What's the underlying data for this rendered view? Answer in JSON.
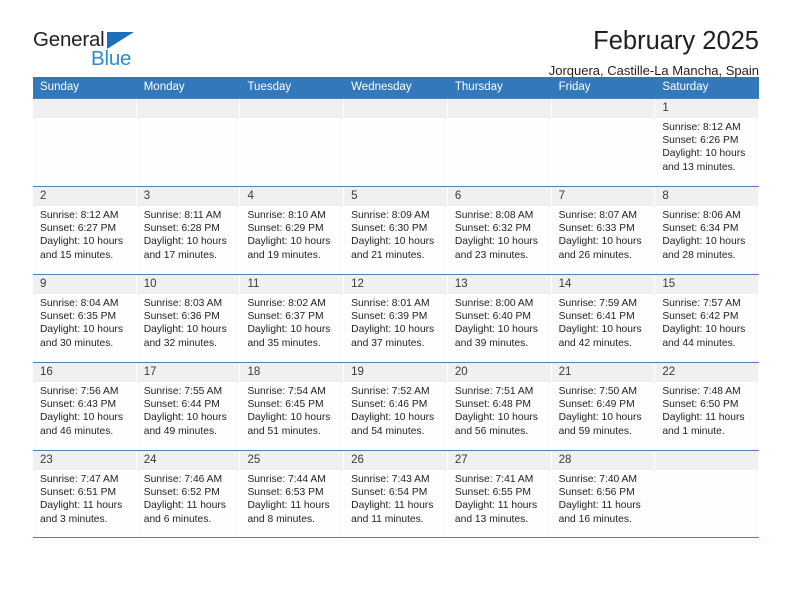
{
  "brand": {
    "name_part1": "General",
    "name_part2": "Blue",
    "triangle_color": "#1c6fba",
    "blue_text_color": "#2e8ad4"
  },
  "header": {
    "title": "February 2025",
    "location": "Jorquera, Castille-La Mancha, Spain"
  },
  "theme": {
    "header_bar_color": "#3478bc",
    "daynum_strip_color": "#f0f0f0",
    "grid_line_color": "#4a84c0",
    "text_color": "#231f20"
  },
  "calendar": {
    "weekdays": [
      "Sunday",
      "Monday",
      "Tuesday",
      "Wednesday",
      "Thursday",
      "Friday",
      "Saturday"
    ],
    "labels": {
      "sunrise": "Sunrise:",
      "sunset": "Sunset:",
      "daylight": "Daylight:"
    },
    "weeks": [
      [
        {
          "day": "",
          "sunrise": "",
          "sunset": "",
          "daylight_line1": "",
          "daylight_line2": ""
        },
        {
          "day": "",
          "sunrise": "",
          "sunset": "",
          "daylight_line1": "",
          "daylight_line2": ""
        },
        {
          "day": "",
          "sunrise": "",
          "sunset": "",
          "daylight_line1": "",
          "daylight_line2": ""
        },
        {
          "day": "",
          "sunrise": "",
          "sunset": "",
          "daylight_line1": "",
          "daylight_line2": ""
        },
        {
          "day": "",
          "sunrise": "",
          "sunset": "",
          "daylight_line1": "",
          "daylight_line2": ""
        },
        {
          "day": "",
          "sunrise": "",
          "sunset": "",
          "daylight_line1": "",
          "daylight_line2": ""
        },
        {
          "day": "1",
          "sunrise": "Sunrise: 8:12 AM",
          "sunset": "Sunset: 6:26 PM",
          "daylight_line1": "Daylight: 10 hours",
          "daylight_line2": "and 13 minutes."
        }
      ],
      [
        {
          "day": "2",
          "sunrise": "Sunrise: 8:12 AM",
          "sunset": "Sunset: 6:27 PM",
          "daylight_line1": "Daylight: 10 hours",
          "daylight_line2": "and 15 minutes."
        },
        {
          "day": "3",
          "sunrise": "Sunrise: 8:11 AM",
          "sunset": "Sunset: 6:28 PM",
          "daylight_line1": "Daylight: 10 hours",
          "daylight_line2": "and 17 minutes."
        },
        {
          "day": "4",
          "sunrise": "Sunrise: 8:10 AM",
          "sunset": "Sunset: 6:29 PM",
          "daylight_line1": "Daylight: 10 hours",
          "daylight_line2": "and 19 minutes."
        },
        {
          "day": "5",
          "sunrise": "Sunrise: 8:09 AM",
          "sunset": "Sunset: 6:30 PM",
          "daylight_line1": "Daylight: 10 hours",
          "daylight_line2": "and 21 minutes."
        },
        {
          "day": "6",
          "sunrise": "Sunrise: 8:08 AM",
          "sunset": "Sunset: 6:32 PM",
          "daylight_line1": "Daylight: 10 hours",
          "daylight_line2": "and 23 minutes."
        },
        {
          "day": "7",
          "sunrise": "Sunrise: 8:07 AM",
          "sunset": "Sunset: 6:33 PM",
          "daylight_line1": "Daylight: 10 hours",
          "daylight_line2": "and 26 minutes."
        },
        {
          "day": "8",
          "sunrise": "Sunrise: 8:06 AM",
          "sunset": "Sunset: 6:34 PM",
          "daylight_line1": "Daylight: 10 hours",
          "daylight_line2": "and 28 minutes."
        }
      ],
      [
        {
          "day": "9",
          "sunrise": "Sunrise: 8:04 AM",
          "sunset": "Sunset: 6:35 PM",
          "daylight_line1": "Daylight: 10 hours",
          "daylight_line2": "and 30 minutes."
        },
        {
          "day": "10",
          "sunrise": "Sunrise: 8:03 AM",
          "sunset": "Sunset: 6:36 PM",
          "daylight_line1": "Daylight: 10 hours",
          "daylight_line2": "and 32 minutes."
        },
        {
          "day": "11",
          "sunrise": "Sunrise: 8:02 AM",
          "sunset": "Sunset: 6:37 PM",
          "daylight_line1": "Daylight: 10 hours",
          "daylight_line2": "and 35 minutes."
        },
        {
          "day": "12",
          "sunrise": "Sunrise: 8:01 AM",
          "sunset": "Sunset: 6:39 PM",
          "daylight_line1": "Daylight: 10 hours",
          "daylight_line2": "and 37 minutes."
        },
        {
          "day": "13",
          "sunrise": "Sunrise: 8:00 AM",
          "sunset": "Sunset: 6:40 PM",
          "daylight_line1": "Daylight: 10 hours",
          "daylight_line2": "and 39 minutes."
        },
        {
          "day": "14",
          "sunrise": "Sunrise: 7:59 AM",
          "sunset": "Sunset: 6:41 PM",
          "daylight_line1": "Daylight: 10 hours",
          "daylight_line2": "and 42 minutes."
        },
        {
          "day": "15",
          "sunrise": "Sunrise: 7:57 AM",
          "sunset": "Sunset: 6:42 PM",
          "daylight_line1": "Daylight: 10 hours",
          "daylight_line2": "and 44 minutes."
        }
      ],
      [
        {
          "day": "16",
          "sunrise": "Sunrise: 7:56 AM",
          "sunset": "Sunset: 6:43 PM",
          "daylight_line1": "Daylight: 10 hours",
          "daylight_line2": "and 46 minutes."
        },
        {
          "day": "17",
          "sunrise": "Sunrise: 7:55 AM",
          "sunset": "Sunset: 6:44 PM",
          "daylight_line1": "Daylight: 10 hours",
          "daylight_line2": "and 49 minutes."
        },
        {
          "day": "18",
          "sunrise": "Sunrise: 7:54 AM",
          "sunset": "Sunset: 6:45 PM",
          "daylight_line1": "Daylight: 10 hours",
          "daylight_line2": "and 51 minutes."
        },
        {
          "day": "19",
          "sunrise": "Sunrise: 7:52 AM",
          "sunset": "Sunset: 6:46 PM",
          "daylight_line1": "Daylight: 10 hours",
          "daylight_line2": "and 54 minutes."
        },
        {
          "day": "20",
          "sunrise": "Sunrise: 7:51 AM",
          "sunset": "Sunset: 6:48 PM",
          "daylight_line1": "Daylight: 10 hours",
          "daylight_line2": "and 56 minutes."
        },
        {
          "day": "21",
          "sunrise": "Sunrise: 7:50 AM",
          "sunset": "Sunset: 6:49 PM",
          "daylight_line1": "Daylight: 10 hours",
          "daylight_line2": "and 59 minutes."
        },
        {
          "day": "22",
          "sunrise": "Sunrise: 7:48 AM",
          "sunset": "Sunset: 6:50 PM",
          "daylight_line1": "Daylight: 11 hours",
          "daylight_line2": "and 1 minute."
        }
      ],
      [
        {
          "day": "23",
          "sunrise": "Sunrise: 7:47 AM",
          "sunset": "Sunset: 6:51 PM",
          "daylight_line1": "Daylight: 11 hours",
          "daylight_line2": "and 3 minutes."
        },
        {
          "day": "24",
          "sunrise": "Sunrise: 7:46 AM",
          "sunset": "Sunset: 6:52 PM",
          "daylight_line1": "Daylight: 11 hours",
          "daylight_line2": "and 6 minutes."
        },
        {
          "day": "25",
          "sunrise": "Sunrise: 7:44 AM",
          "sunset": "Sunset: 6:53 PM",
          "daylight_line1": "Daylight: 11 hours",
          "daylight_line2": "and 8 minutes."
        },
        {
          "day": "26",
          "sunrise": "Sunrise: 7:43 AM",
          "sunset": "Sunset: 6:54 PM",
          "daylight_line1": "Daylight: 11 hours",
          "daylight_line2": "and 11 minutes."
        },
        {
          "day": "27",
          "sunrise": "Sunrise: 7:41 AM",
          "sunset": "Sunset: 6:55 PM",
          "daylight_line1": "Daylight: 11 hours",
          "daylight_line2": "and 13 minutes."
        },
        {
          "day": "28",
          "sunrise": "Sunrise: 7:40 AM",
          "sunset": "Sunset: 6:56 PM",
          "daylight_line1": "Daylight: 11 hours",
          "daylight_line2": "and 16 minutes."
        },
        {
          "day": "",
          "sunrise": "",
          "sunset": "",
          "daylight_line1": "",
          "daylight_line2": ""
        }
      ]
    ]
  }
}
